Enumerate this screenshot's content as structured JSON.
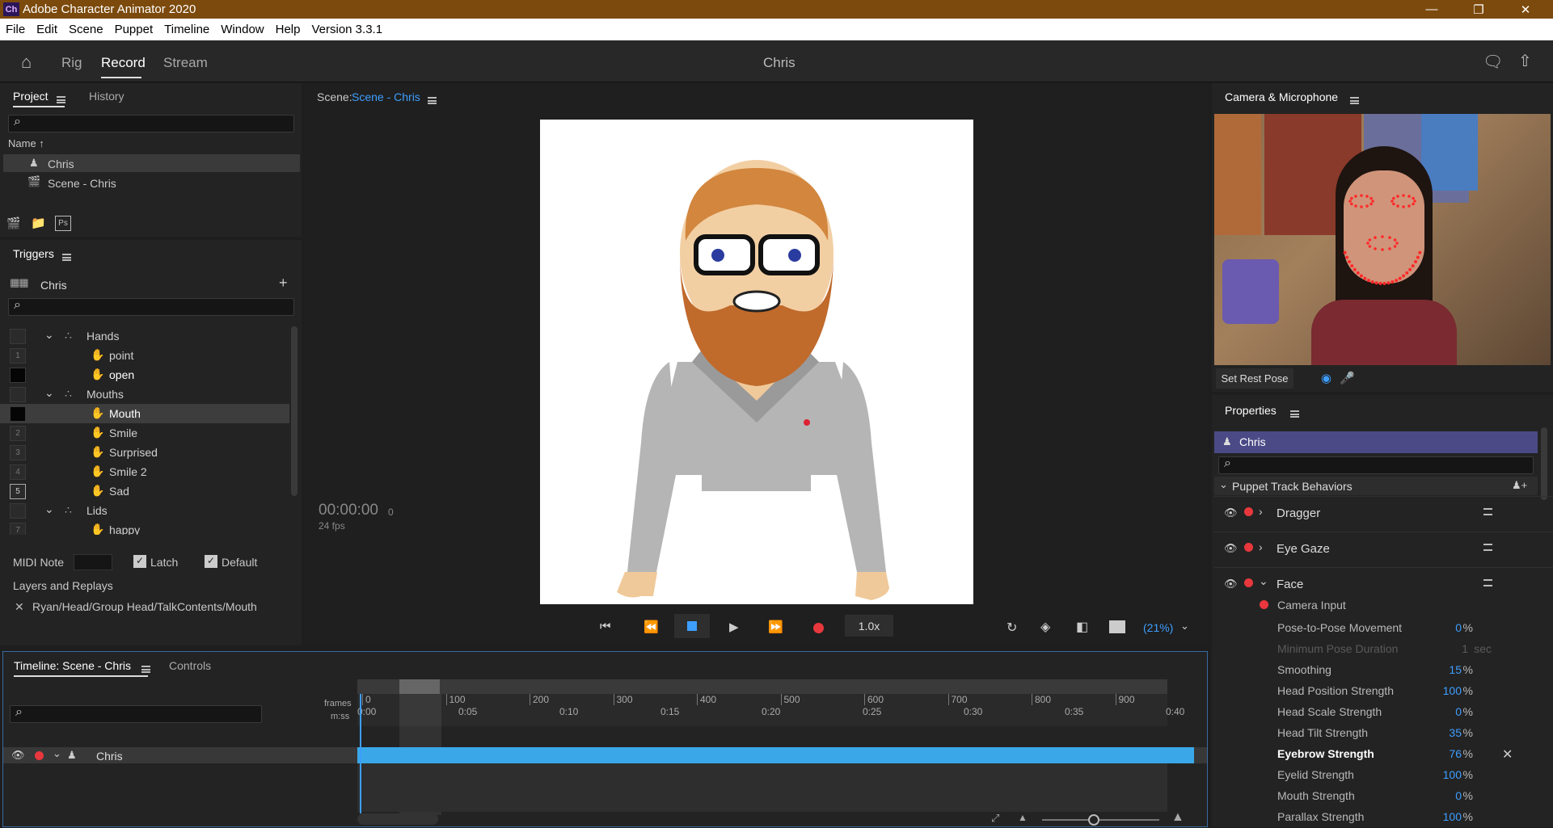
{
  "window": {
    "title": "Adobe Character Animator 2020",
    "logo": "Ch"
  },
  "menu": [
    "File",
    "Edit",
    "Scene",
    "Puppet",
    "Timeline",
    "Window",
    "Help",
    "Version 3.3.1"
  ],
  "nav": {
    "tabs": [
      "Rig",
      "Record",
      "Stream"
    ],
    "active": "Record",
    "center_title": "Chris"
  },
  "project": {
    "tab_active": "Project",
    "tab_other": "History",
    "column": "Name ↑",
    "items": [
      "Chris",
      "Scene - Chris"
    ]
  },
  "triggers": {
    "title": "Triggers",
    "puppet": "Chris",
    "rows": [
      {
        "key": "",
        "label": "Hands",
        "type": "group"
      },
      {
        "key": "1",
        "label": "point",
        "type": "item"
      },
      {
        "key": "",
        "label": "open",
        "type": "item"
      },
      {
        "key": "",
        "label": "Mouths",
        "type": "group"
      },
      {
        "key": "",
        "label": "Mouth",
        "type": "item"
      },
      {
        "key": "2",
        "label": "Smile",
        "type": "item"
      },
      {
        "key": "3",
        "label": "Surprised",
        "type": "item"
      },
      {
        "key": "4",
        "label": "Smile 2",
        "type": "item"
      },
      {
        "key": "5",
        "label": "Sad",
        "type": "item"
      },
      {
        "key": "",
        "label": "Lids",
        "type": "group"
      },
      {
        "key": "7",
        "label": "happy",
        "type": "item"
      }
    ],
    "midi_label": "MIDI Note",
    "latch_label": "Latch",
    "default_label": "Default",
    "layers_title": "Layers and Replays",
    "layer_path": "Ryan/Head/Group Head/TalkContents/Mouth"
  },
  "scene": {
    "label": "Scene:",
    "name": "Scene - Chris",
    "timecode": "00:00:00",
    "frame": "0",
    "fps": "24 fps",
    "speed": "1.0x",
    "zoom": "(21%)"
  },
  "camera": {
    "title": "Camera & Microphone",
    "rest_pose": "Set Rest Pose"
  },
  "properties": {
    "title": "Properties",
    "puppet": "Chris",
    "section": "Puppet Track Behaviors",
    "behaviors": [
      "Dragger",
      "Eye Gaze",
      "Face"
    ],
    "camera_input": "Camera Input",
    "params": [
      {
        "name": "Pose-to-Pose Movement",
        "value": "0",
        "unit": "%",
        "dim": false,
        "bold": false
      },
      {
        "name": "Minimum Pose Duration",
        "value": "1",
        "unit": "sec",
        "dim": true,
        "bold": false
      },
      {
        "name": "Smoothing",
        "value": "15",
        "unit": "%",
        "dim": false,
        "bold": false
      },
      {
        "name": "Head Position Strength",
        "value": "100",
        "unit": "%",
        "dim": false,
        "bold": false
      },
      {
        "name": "Head Scale Strength",
        "value": "0",
        "unit": "%",
        "dim": false,
        "bold": false
      },
      {
        "name": "Head Tilt Strength",
        "value": "35",
        "unit": "%",
        "dim": false,
        "bold": false
      },
      {
        "name": "Eyebrow Strength",
        "value": "76",
        "unit": "%",
        "dim": false,
        "bold": true
      },
      {
        "name": "Eyelid Strength",
        "value": "100",
        "unit": "%",
        "dim": false,
        "bold": false
      },
      {
        "name": "Mouth Strength",
        "value": "0",
        "unit": "%",
        "dim": false,
        "bold": false
      },
      {
        "name": "Parallax Strength",
        "value": "100",
        "unit": "%",
        "dim": false,
        "bold": false
      }
    ]
  },
  "timeline": {
    "title": "Timeline: Scene - Chris",
    "controls_tab": "Controls",
    "frames_label": "frames",
    "mss_label": "m:ss",
    "frame_ticks": [
      "0",
      "100",
      "200",
      "300",
      "400",
      "500",
      "600",
      "700",
      "800",
      "900"
    ],
    "time_ticks": [
      "0:00",
      "0:05",
      "0:10",
      "0:15",
      "0:20",
      "0:25",
      "0:30",
      "0:35",
      "0:40"
    ],
    "track": "Chris"
  }
}
